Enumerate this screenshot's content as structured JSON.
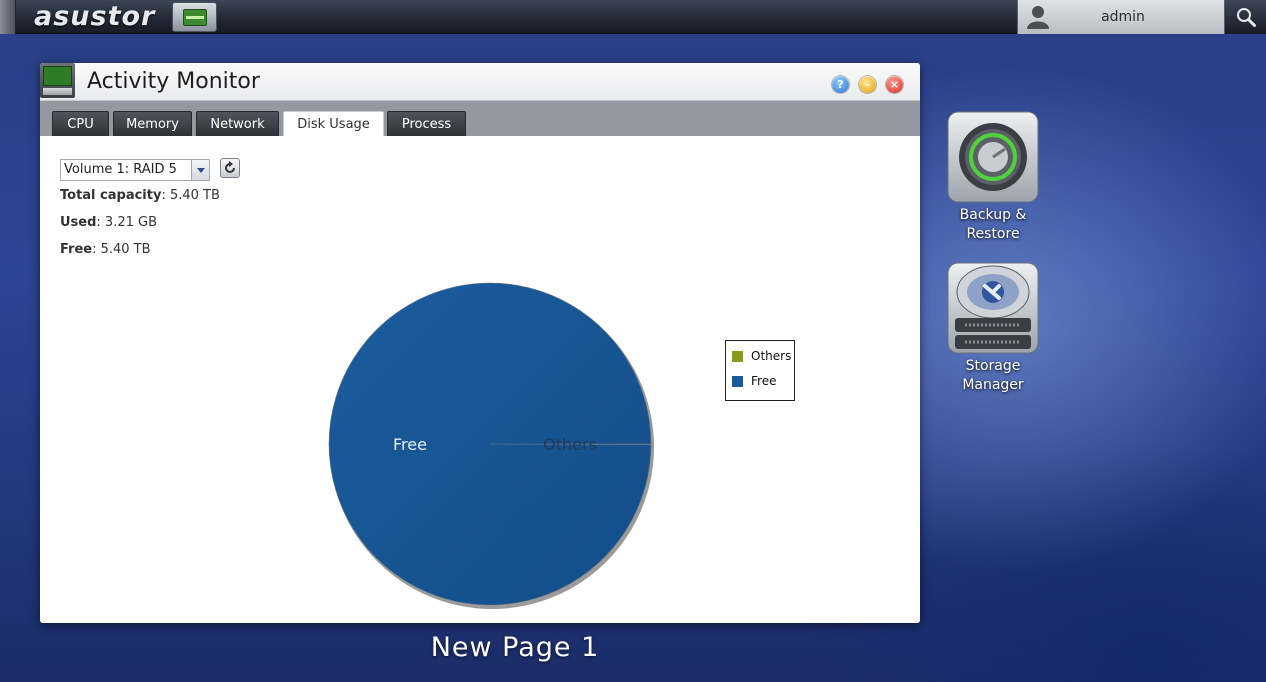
{
  "topbar": {
    "logo": "asustor",
    "user": "admin",
    "user_icon": "user-icon",
    "search_icon": "search-icon"
  },
  "window": {
    "title": "Activity Monitor",
    "buttons": {
      "help": "?",
      "minimize": "–",
      "close": "×"
    },
    "tabs": [
      {
        "label": "CPU",
        "active": false
      },
      {
        "label": "Memory",
        "active": false
      },
      {
        "label": "Network",
        "active": false
      },
      {
        "label": "Disk Usage",
        "active": true
      },
      {
        "label": "Process",
        "active": false
      }
    ],
    "volume_select": {
      "selected": "Volume 1: RAID 5"
    },
    "stats": {
      "total_label": "Total capacity",
      "total_value": ": 5.40 TB",
      "used_label": "Used",
      "used_value": ": 3.21 GB",
      "free_label": "Free",
      "free_value": ": 5.40 TB"
    }
  },
  "chart_data": {
    "type": "pie",
    "slices": [
      {
        "label": "Others",
        "value": 0.06,
        "color": "#8a9a1b"
      },
      {
        "label": "Free",
        "value": 99.94,
        "color": "#1a5a9a"
      }
    ],
    "legend": [
      "Others",
      "Free"
    ],
    "legend_position": "right"
  },
  "desktop": {
    "icons": [
      {
        "label": "Backup & Restore",
        "icon": "backup-restore-icon"
      },
      {
        "label": "Storage Manager",
        "icon": "storage-manager-icon"
      }
    ]
  },
  "page_label": "New Page 1"
}
